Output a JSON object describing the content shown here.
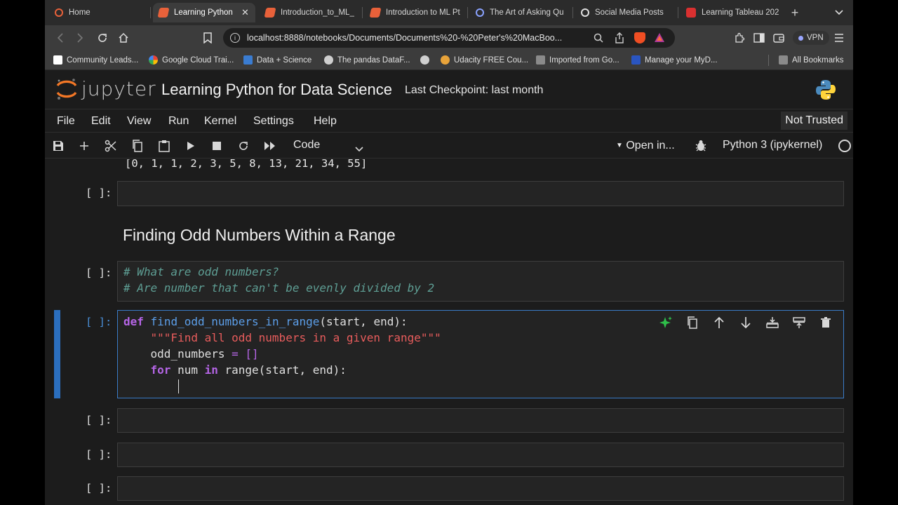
{
  "browser": {
    "tabs": [
      {
        "label": "Home",
        "color": "#e8613a"
      },
      {
        "label": "Learning Python",
        "color": "#e8613a"
      },
      {
        "label": "Introduction_to_ML_",
        "color": "#e8613a"
      },
      {
        "label": "Introduction to ML Pt",
        "color": "#e8613a"
      },
      {
        "label": "The Art of Asking Qu",
        "color": "#4a6ee0"
      },
      {
        "label": "Social Media Posts",
        "color": "#e0e0e0"
      },
      {
        "label": "Learning Tableau 202",
        "color": "#d93030"
      }
    ],
    "tab_close": "✕",
    "new_tab": "+",
    "url": "localhost:8888/notebooks/Documents/Documents%20-%20Peter's%20MacBoo...",
    "vpn_label": "VPN",
    "bookmarks": [
      {
        "label": "Community Leads...",
        "color": "#ffffff"
      },
      {
        "label": "Google Cloud Trai...",
        "color": "#4285f4"
      },
      {
        "label": "Data + Science",
        "color": "#3a7cd1"
      },
      {
        "label": "The pandas DataF...",
        "color": "#cfcfcf"
      },
      {
        "label": "",
        "color": "#cfcfcf"
      },
      {
        "label": "Udacity FREE Cou...",
        "color": "#e8a33a"
      },
      {
        "label": "Imported from Go...",
        "color": "#8a8a8a"
      },
      {
        "label": "Manage your MyD...",
        "color": "#2a55c0"
      }
    ],
    "all_bookmarks": "All Bookmarks"
  },
  "jupyter": {
    "logo_text": "jupyter",
    "notebook_title": "Learning Python for Data Science",
    "checkpoint": "Last Checkpoint: last month",
    "menu": [
      "File",
      "Edit",
      "View",
      "Run",
      "Kernel",
      "Settings",
      "Help"
    ],
    "trusted": "Not Trusted",
    "cell_type": "Code",
    "open_in": "Open in...",
    "kernel_name": "Python 3 (ipykernel)"
  },
  "notebook": {
    "prev_output": "[0, 1, 1, 2, 3, 5, 8, 13, 21, 34, 55]",
    "prompt": "[ ]:",
    "markdown_heading": "Finding Odd Numbers Within a Range",
    "comment_lines": [
      "# What are odd numbers?",
      "# Are number that can't be evenly divided by 2"
    ],
    "code": {
      "line1_kw": "def",
      "line1_fn": "find_odd_numbers_in_range",
      "line1_rest": "(start, end):",
      "line2": "\"\"\"Find all odd numbers in a given range\"\"\"",
      "line3_var": "odd_numbers",
      "line3_eq": " = ",
      "line3_val": "[]",
      "line4_kw": "for",
      "line4_mid": " num ",
      "line4_kw2": "in",
      "line4_rest": " range(start, end):"
    }
  },
  "colors": {
    "accent": "#3a7cc9",
    "jupyter_orange": "#f37726"
  }
}
